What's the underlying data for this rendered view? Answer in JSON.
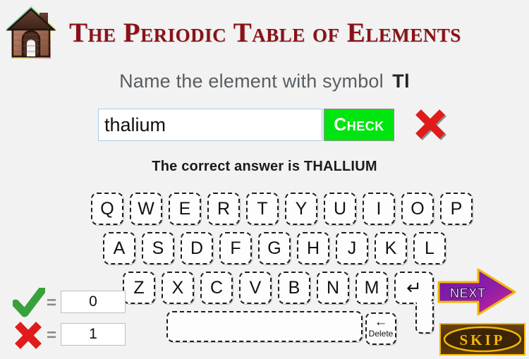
{
  "header": {
    "title": "The Periodic Table of Elements",
    "home_icon": "home-icon"
  },
  "question": {
    "prompt": "Name the element with symbol",
    "symbol": "Tl"
  },
  "answer": {
    "value": "thalium",
    "placeholder": "",
    "check_label": "Check",
    "result_icon": "red-x-icon"
  },
  "feedback": {
    "text": "The correct answer is THALLIUM"
  },
  "keyboard": {
    "row1": [
      "Q",
      "W",
      "E",
      "R",
      "T",
      "Y",
      "U",
      "I",
      "O",
      "P"
    ],
    "row2": [
      "A",
      "S",
      "D",
      "F",
      "G",
      "H",
      "J",
      "K",
      "L"
    ],
    "row3": [
      "Z",
      "X",
      "C",
      "V",
      "B",
      "N",
      "M"
    ],
    "enter_label": "↵",
    "space_label": "",
    "delete_arrow": "←",
    "delete_label": "Delete"
  },
  "score": {
    "correct_icon": "green-check-icon",
    "correct_value": "0",
    "wrong_icon": "red-x-icon",
    "wrong_value": "1",
    "equals": "="
  },
  "actions": {
    "next_label": "NEXT",
    "skip_label": "SKIP"
  },
  "colors": {
    "background": "#f2f2f2",
    "title": "#8b1116",
    "check_button": "#00e510",
    "wrong_red": "#e01b1b",
    "correct_green": "#37a23a",
    "question_text": "#585e63",
    "next_purple": "#7a1fa8",
    "next_magenta": "#d4258e",
    "gold": "#f2b705"
  }
}
